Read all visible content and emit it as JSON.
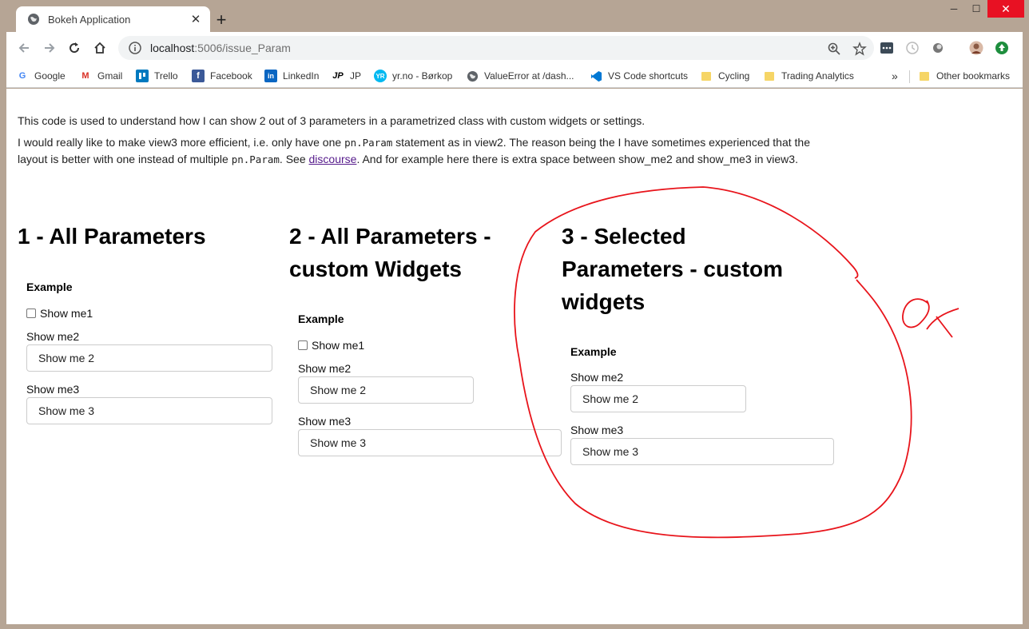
{
  "browser": {
    "tab": {
      "title": "Bokeh Application",
      "close_glyph": "✕"
    },
    "new_tab_glyph": "+",
    "window_controls": {
      "minimize": "─",
      "maximize": "☐",
      "close": "✕"
    },
    "address_bar": {
      "host": "localhost",
      "path": ":5006/issue_Param"
    },
    "bookmarks": [
      {
        "label": "Google",
        "icon": "google-icon"
      },
      {
        "label": "Gmail",
        "icon": "gmail-icon"
      },
      {
        "label": "Trello",
        "icon": "trello-icon"
      },
      {
        "label": "Facebook",
        "icon": "facebook-icon"
      },
      {
        "label": "LinkedIn",
        "icon": "linkedin-icon"
      },
      {
        "label": "JP",
        "icon": "jp-icon"
      },
      {
        "label": "yr.no - Børkop",
        "icon": "yr-icon"
      },
      {
        "label": "ValueError at /dash...",
        "icon": "globe-icon"
      },
      {
        "label": "VS Code shortcuts",
        "icon": "vscode-icon"
      },
      {
        "label": "Cycling",
        "icon": "folder-icon"
      },
      {
        "label": "Trading Analytics",
        "icon": "folder-icon"
      }
    ],
    "bookmarks_overflow": "»",
    "other_bookmarks": "Other bookmarks"
  },
  "page": {
    "intro": "This code is used to understand how I can show 2 out of 3 parameters in a parametrized class with custom widgets or settings.",
    "para2_a": "I would really like to make view3 more efficient, i.e. only have one ",
    "para2_code1": "pn.Param",
    "para2_b": " statement as in view2. The reason being the I have sometimes experienced that the layout is better with one instead of multiple ",
    "para2_code2": "pn.Param",
    "para2_c": ". See ",
    "para2_link": "discourse",
    "para2_d": ". And for example here there is extra space between show_me2 and show_me3 in view3.",
    "columns": [
      {
        "heading": "1 - All Parameters",
        "example": "Example",
        "checkbox_label": "Show me1",
        "field2_label": "Show me2",
        "field2_value": "Show me 2",
        "field3_label": "Show me3",
        "field3_value": "Show me 3"
      },
      {
        "heading": "2 - All Parameters - custom Widgets",
        "example": "Example",
        "checkbox_label": "Show me1",
        "field2_label": "Show me2",
        "field2_value": "Show me 2",
        "field3_label": "Show me3",
        "field3_value": "Show me 3"
      },
      {
        "heading": "3 - Selected Parameters - custom widgets",
        "example": "Example",
        "field2_label": "Show me2",
        "field2_value": "Show me 2",
        "field3_label": "Show me3",
        "field3_value": "Show me 3"
      }
    ],
    "annotation": {
      "color": "#e8141b"
    }
  }
}
